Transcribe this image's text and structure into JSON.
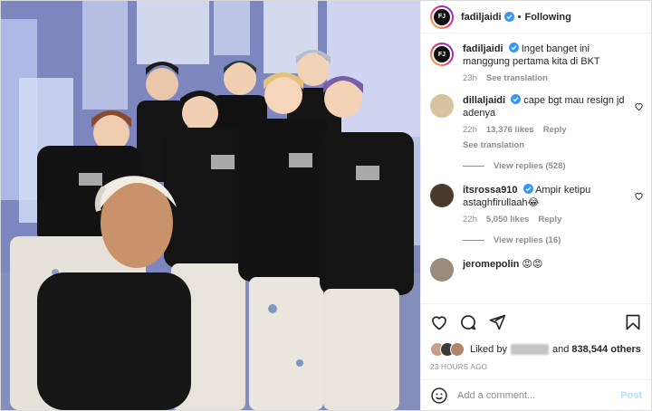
{
  "header": {
    "username": "fadiljaidi",
    "separator": "•",
    "follow_label": "Following"
  },
  "caption": {
    "username": "fadiljaidi",
    "text": "Inget banget ini manggung pertama kita di BKT",
    "age": "23h",
    "translation_link": "See translation"
  },
  "comments": [
    {
      "username": "dillaljaidi",
      "text": "cape bgt mau resign jd adenya",
      "age": "22h",
      "likes": "13,376 likes",
      "reply_label": "Reply",
      "translation_link": "See translation",
      "view_replies": "View replies (528)"
    },
    {
      "username": "itsrossa910",
      "text": "Ampir ketipu astaghfirullaah😂",
      "age": "22h",
      "likes": "5,050 likes",
      "reply_label": "Reply",
      "view_replies": "View replies (16)"
    },
    {
      "username": "jeromepolin",
      "text": "😡😡"
    }
  ],
  "likes_line": {
    "prefix": "Liked by",
    "conjunction": "and",
    "count": "838,544 others"
  },
  "timestamp": "23 HOURS AGO",
  "add_comment": {
    "placeholder": "Add a comment...",
    "post_label": "Post"
  },
  "colors": {
    "verified": "#3897f0",
    "post_button": "#b2dffc",
    "muted": "#8e8e8e"
  },
  "icons": [
    "heart-icon",
    "comment-icon",
    "share-icon",
    "bookmark-icon",
    "emoji-icon",
    "verified-badge-icon"
  ]
}
